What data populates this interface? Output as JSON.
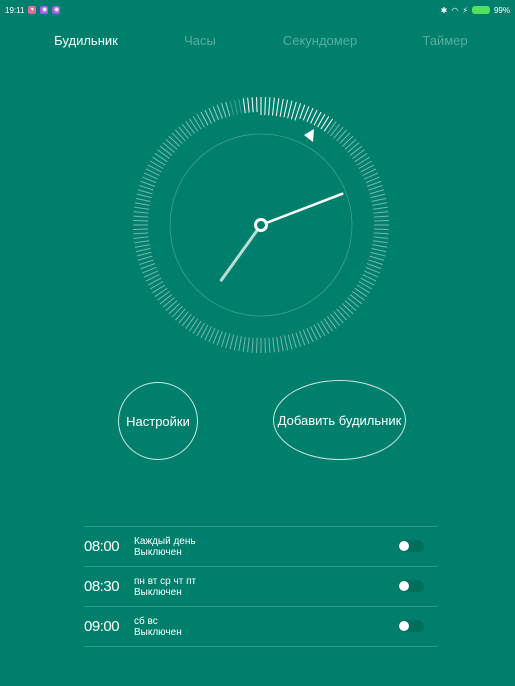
{
  "status_bar": {
    "time": "19:11",
    "battery_text": "99%",
    "notification_icons": [
      "notification-icon-1",
      "notification-icon-2",
      "notification-icon-3"
    ]
  },
  "tabs": [
    {
      "label": "Будильник",
      "active": true
    },
    {
      "label": "Часы",
      "active": false
    },
    {
      "label": "Секундомер",
      "active": false
    },
    {
      "label": "Таймер",
      "active": false
    }
  ],
  "clock": {
    "hour": 7,
    "minute": 11.5
  },
  "buttons": {
    "settings_label": "Настройки",
    "add_alarm_label": "Добавить будильник"
  },
  "alarms": [
    {
      "time": "08:00",
      "repeat": "Каждый день",
      "status": "Выключен",
      "enabled": false
    },
    {
      "time": "08:30",
      "repeat": "пн вт ср чт пт",
      "status": "Выключен",
      "enabled": false
    },
    {
      "time": "09:00",
      "repeat": "сб вс",
      "status": "Выключен",
      "enabled": false
    }
  ],
  "colors": {
    "background": "#00806c",
    "battery": "#53e05f",
    "notification_1": "#e06c9f",
    "notification_2": "#a45de8",
    "notification_3": "#a45de8"
  }
}
